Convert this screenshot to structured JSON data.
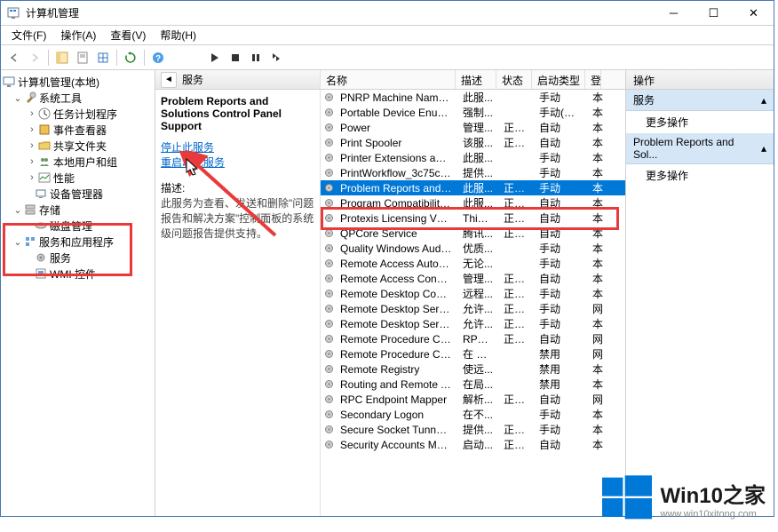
{
  "window": {
    "title": "计算机管理"
  },
  "menu": {
    "file": "文件(F)",
    "action": "操作(A)",
    "view": "查看(V)",
    "help": "帮助(H)"
  },
  "tree": {
    "root": "计算机管理(本地)",
    "systools": "系统工具",
    "task": "任务计划程序",
    "event": "事件查看器",
    "shared": "共享文件夹",
    "users": "本地用户和组",
    "perf": "性能",
    "devmgr": "设备管理器",
    "storage": "存储",
    "diskmgr": "磁盘管理",
    "apps": "服务和应用程序",
    "services": "服务",
    "wmi": "WMI 控件"
  },
  "svc": {
    "tabs_services": "服务",
    "title": "Problem Reports and Solutions Control Panel Support",
    "stop": "停止此服务",
    "restart": "重启动此服务",
    "desc_label": "描述:",
    "desc": "此服务为查看、发送和删除\"问题报告和解决方案\"控制面板的系统级问题报告提供支持。"
  },
  "cols": {
    "name": "名称",
    "desc": "描述",
    "status": "状态",
    "startup": "启动类型",
    "last": "登"
  },
  "rows": [
    {
      "name": "PNRP Machine Name Pu...",
      "desc": "此服...",
      "status": "",
      "startup": "手动",
      "last": "本"
    },
    {
      "name": "Portable Device Enumera...",
      "desc": "强制...",
      "status": "",
      "startup": "手动(触发...",
      "last": "本"
    },
    {
      "name": "Power",
      "desc": "管理...",
      "status": "正在...",
      "startup": "自动",
      "last": "本"
    },
    {
      "name": "Print Spooler",
      "desc": "该服...",
      "status": "正在...",
      "startup": "自动",
      "last": "本"
    },
    {
      "name": "Printer Extensions and N...",
      "desc": "此服...",
      "status": "",
      "startup": "手动",
      "last": "本"
    },
    {
      "name": "PrintWorkflow_3c75c03d",
      "desc": "提供...",
      "status": "",
      "startup": "手动",
      "last": "本"
    },
    {
      "name": "Problem Reports and Sol...",
      "desc": "此服...",
      "status": "正在...",
      "startup": "手动",
      "last": "本",
      "sel": true
    },
    {
      "name": "Program Compatibility As...",
      "desc": "此服...",
      "status": "正在...",
      "startup": "自动",
      "last": "本"
    },
    {
      "name": "Protexis Licensing V2 x64",
      "desc": "This ...",
      "status": "正在...",
      "startup": "自动",
      "last": "本"
    },
    {
      "name": "QPCore Service",
      "desc": "腾讯...",
      "status": "正在...",
      "startup": "自动",
      "last": "本"
    },
    {
      "name": "Quality Windows Audio V...",
      "desc": "优质...",
      "status": "",
      "startup": "手动",
      "last": "本"
    },
    {
      "name": "Remote Access Auto Con...",
      "desc": "无论...",
      "status": "",
      "startup": "手动",
      "last": "本"
    },
    {
      "name": "Remote Access Connecti...",
      "desc": "管理...",
      "status": "正在...",
      "startup": "自动",
      "last": "本"
    },
    {
      "name": "Remote Desktop Configu...",
      "desc": "远程...",
      "status": "正在...",
      "startup": "手动",
      "last": "本"
    },
    {
      "name": "Remote Desktop Services",
      "desc": "允许...",
      "status": "正在...",
      "startup": "手动",
      "last": "网"
    },
    {
      "name": "Remote Desktop Service...",
      "desc": "允许...",
      "status": "正在...",
      "startup": "手动",
      "last": "本"
    },
    {
      "name": "Remote Procedure Call (...",
      "desc": "RPC...",
      "status": "正在...",
      "startup": "自动",
      "last": "网"
    },
    {
      "name": "Remote Procedure Call (...",
      "desc": "在 W...",
      "status": "",
      "startup": "禁用",
      "last": "网"
    },
    {
      "name": "Remote Registry",
      "desc": "使远...",
      "status": "",
      "startup": "禁用",
      "last": "本"
    },
    {
      "name": "Routing and Remote Acc...",
      "desc": "在局...",
      "status": "",
      "startup": "禁用",
      "last": "本"
    },
    {
      "name": "RPC Endpoint Mapper",
      "desc": "解析...",
      "status": "正在...",
      "startup": "自动",
      "last": "网"
    },
    {
      "name": "Secondary Logon",
      "desc": "在不...",
      "status": "",
      "startup": "手动",
      "last": "本"
    },
    {
      "name": "Secure Socket Tunneling ...",
      "desc": "提供...",
      "status": "正在...",
      "startup": "手动",
      "last": "本"
    },
    {
      "name": "Security Accounts Manag...",
      "desc": "启动...",
      "status": "正在...",
      "startup": "自动",
      "last": "本"
    }
  ],
  "actions": {
    "header": "操作",
    "services": "服务",
    "more": "更多操作",
    "selected": "Problem Reports and Sol..."
  },
  "watermark": {
    "text": "Win10之家",
    "url": "www.win10xitong.com"
  }
}
